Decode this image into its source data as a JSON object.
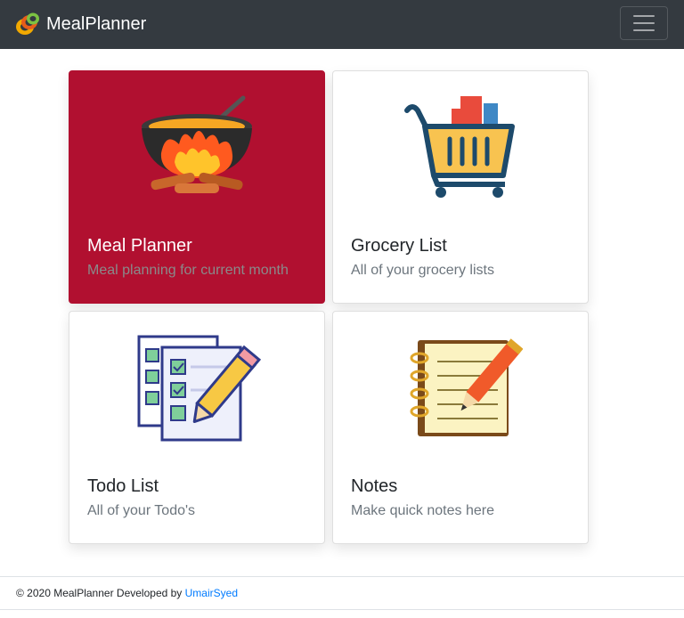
{
  "navbar": {
    "brand": "MealPlanner",
    "logo_icon": "food-rings-logo-icon",
    "menu_icon": "hamburger-menu-icon"
  },
  "cards": [
    {
      "title": "Meal Planner",
      "text": "Meal planning for current month",
      "icon": "cooking-pot-fire-icon",
      "active": true
    },
    {
      "title": "Grocery List",
      "text": "All of your grocery lists",
      "icon": "shopping-cart-icon",
      "active": false
    },
    {
      "title": "Todo List",
      "text": "All of your Todo's",
      "icon": "checklist-pencil-icon",
      "active": false
    },
    {
      "title": "Notes",
      "text": "Make quick notes here",
      "icon": "notebook-pencil-icon",
      "active": false
    }
  ],
  "footer": {
    "copyright": "© 2020 MealPlanner Developed by ",
    "author": "UmairSyed"
  },
  "colors": {
    "navbar": "#343a40",
    "active_card": "#b11030",
    "link": "#007bff",
    "muted_text": "#6c757d"
  }
}
